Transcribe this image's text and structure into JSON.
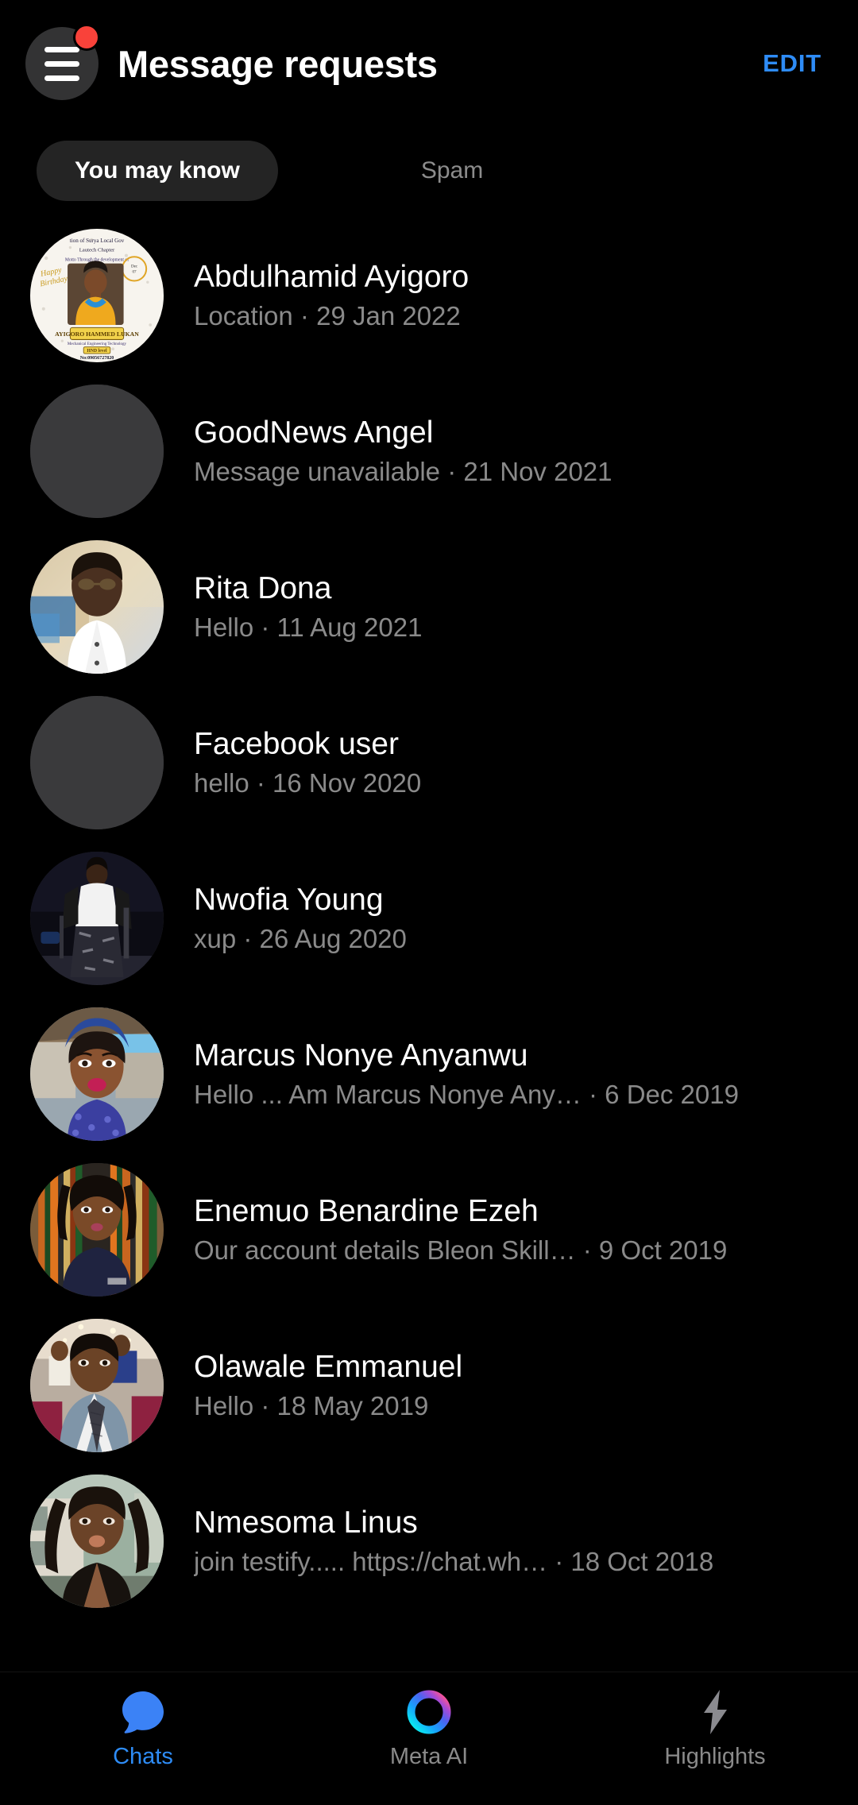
{
  "header": {
    "title": "Message requests",
    "edit_label": "EDIT",
    "menu_icon": "hamburger-menu-icon",
    "badge_icon": "notification-dot",
    "edit_color": "#2e8cf6",
    "badge_color": "#f9423a"
  },
  "tabs": [
    {
      "label": "You may know",
      "active": true
    },
    {
      "label": "Spam",
      "active": false
    }
  ],
  "requests": [
    {
      "name": "Abdulhamid Ayigoro",
      "snippet": "Location · 29 Jan 2022",
      "avatar": "poster-photo"
    },
    {
      "name": "GoodNews Angel",
      "snippet": "Message unavailable · 21 Nov 2021",
      "avatar": "placeholder-blank"
    },
    {
      "name": "Rita Dona",
      "snippet": "Hello · 11 Aug 2021",
      "avatar": "portrait-white-shirt"
    },
    {
      "name": "Facebook user",
      "snippet": "hello · 16 Nov 2020",
      "avatar": "placeholder-blank"
    },
    {
      "name": "Nwofia Young",
      "snippet": "xup · 26 Aug 2020",
      "avatar": "portrait-dark-stage"
    },
    {
      "name": "Marcus Nonye Anyanwu",
      "snippet": "Hello ... Am Marcus Nonye Any… · 6 Dec 2019",
      "avatar": "portrait-blue-outfit"
    },
    {
      "name": "Enemuo Benardine Ezeh",
      "snippet": "Our account details  Bleon Skill… · 9 Oct 2019",
      "avatar": "portrait-striped-backdrop"
    },
    {
      "name": "Olawale Emmanuel",
      "snippet": "Hello · 18 May 2019",
      "avatar": "portrait-suit-event"
    },
    {
      "name": "Nmesoma Linus",
      "snippet": "join testify..... https://chat.wh…   · 18 Oct 2018",
      "avatar": "portrait-outdoor-house"
    }
  ],
  "bottomnav": [
    {
      "label": "Chats",
      "icon": "chat-bubble-icon",
      "active": true
    },
    {
      "label": "Meta AI",
      "icon": "meta-ai-ring-icon",
      "active": false
    },
    {
      "label": "Highlights",
      "icon": "lightning-bolt-icon",
      "active": false
    }
  ]
}
